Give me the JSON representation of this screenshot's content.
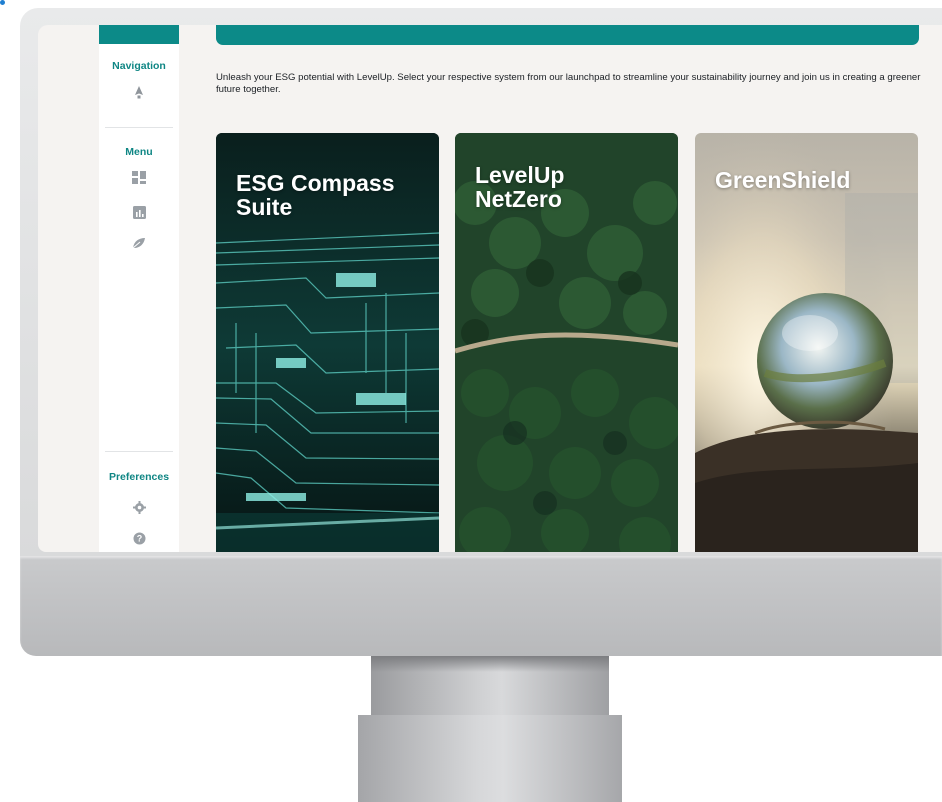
{
  "sidebar": {
    "navigation_heading": "Navigation",
    "menu_heading": "Menu",
    "preferences_heading": "Preferences",
    "icons": {
      "navigation": "rocket-icon",
      "menu": [
        "dashboard-icon",
        "bar-chart-icon",
        "leaf-icon"
      ],
      "preferences": [
        "gear-icon",
        "help-icon"
      ]
    }
  },
  "main": {
    "intro_text": "Unleash your ESG potential with LevelUp. Select your respective system from our launchpad to streamline your sustainability journey and join us in creating a greener future together.",
    "cards": [
      {
        "title_line1": "ESG Compass",
        "title_line2": "Suite"
      },
      {
        "title_line1": "LevelUp",
        "title_line2": "NetZero"
      },
      {
        "title_line1": "GreenShield"
      }
    ]
  },
  "colors": {
    "accent": "#0c8a88",
    "heading_teal": "#0f8684",
    "screen_bg": "#f5f3f1",
    "sidebar_bg": "#ffffff"
  }
}
